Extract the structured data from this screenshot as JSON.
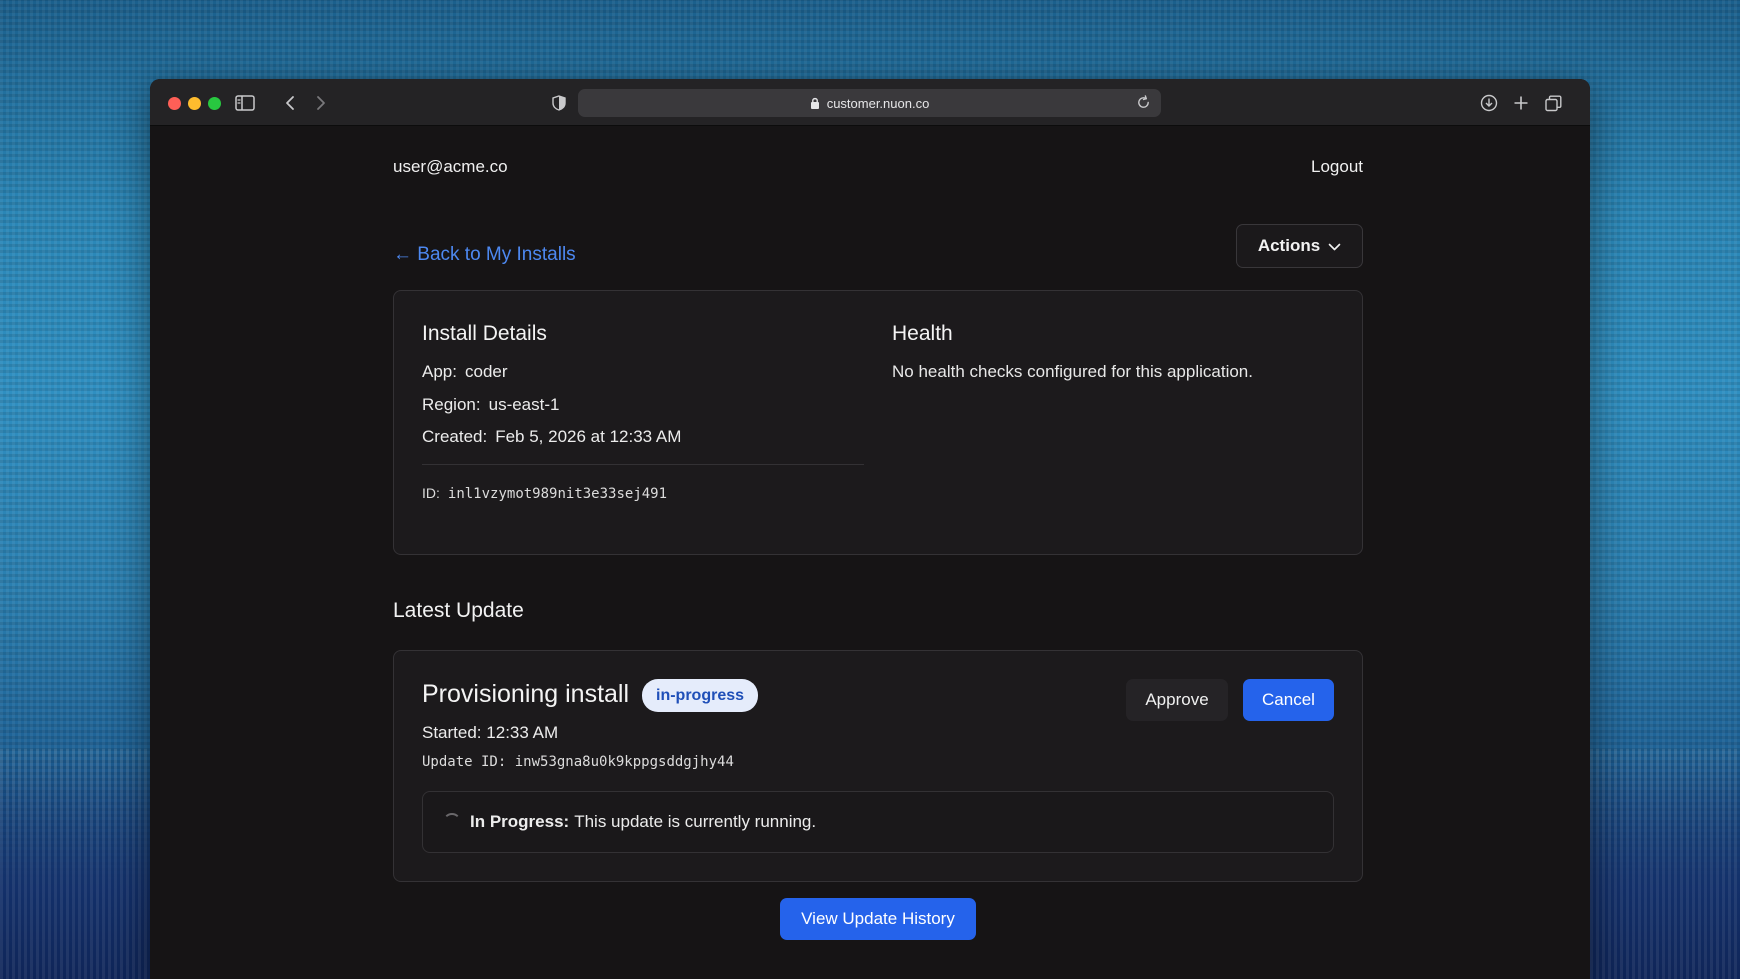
{
  "browser": {
    "url": "customer.nuon.co"
  },
  "header": {
    "user_email": "user@acme.co",
    "logout_label": "Logout"
  },
  "nav": {
    "back_label": "← Back to My Installs",
    "actions_label": "Actions"
  },
  "install_details": {
    "title": "Install Details",
    "app_label": "App:",
    "app_value": "coder",
    "region_label": "Region:",
    "region_value": "us-east-1",
    "created_label": "Created:",
    "created_value": "Feb 5, 2026 at 12:33 AM",
    "id_label": "ID:",
    "id_value": "inl1vzymot989nit3e33sej491"
  },
  "health": {
    "title": "Health",
    "message": "No health checks configured for this application."
  },
  "latest_update": {
    "section_title": "Latest Update",
    "title": "Provisioning install",
    "status_badge": "in-progress",
    "approve_label": "Approve",
    "cancel_label": "Cancel",
    "started_label": "Started:",
    "started_value": "12:33 AM",
    "update_id_label": "Update ID:",
    "update_id_value": "inw53gna8u0k9kppgsddgjhy44",
    "progress_label": "In Progress:",
    "progress_message": "This update is currently running."
  },
  "footer": {
    "history_label": "View Update History"
  },
  "colors": {
    "accent": "#2563eb",
    "link": "#4d88f0",
    "badge_bg": "#e5ecfb",
    "badge_text": "#1f4fb8"
  }
}
